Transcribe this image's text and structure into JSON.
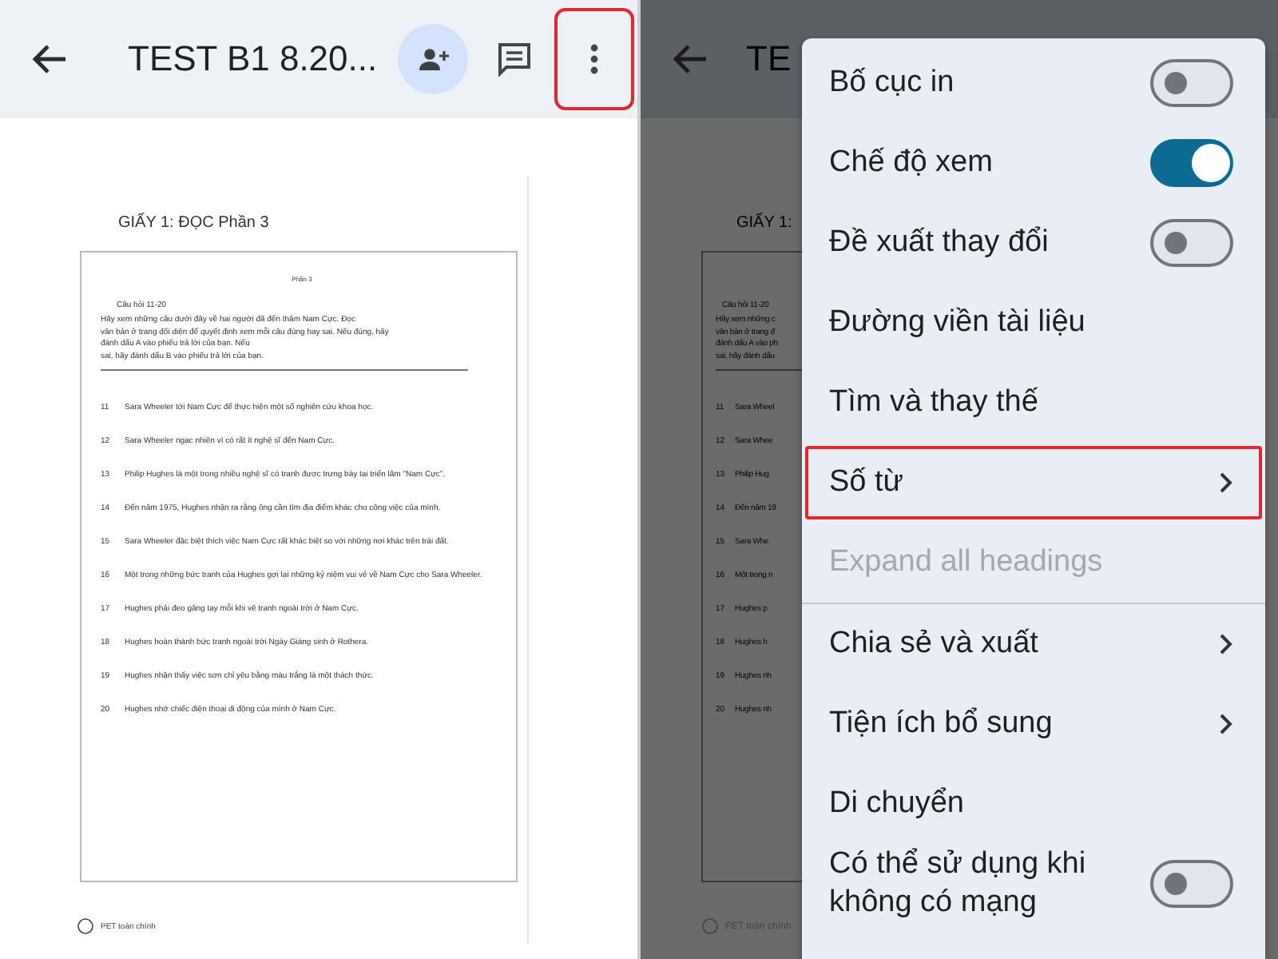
{
  "left_screen": {
    "top_bar": {
      "title": "TEST B1 8.20...",
      "actions": [
        {
          "kind": "add-person",
          "highlighted": false
        },
        {
          "kind": "comment",
          "highlighted": false
        },
        {
          "kind": "more",
          "highlighted": true
        }
      ]
    },
    "document": {
      "heading": "GIẤY 1: ĐỌC Phần 3",
      "section_label": "Phần 3",
      "question_range": "Câu hỏi 11-20",
      "instruction_lines": [
        "Hãy xem những câu dưới đây về hai người đã đến thăm Nam Cực. Đọc",
        "văn bản ở trang đối diện để quyết định xem mỗi câu đúng hay sai. Nếu đúng, hãy",
        "đánh dấu A vào phiếu trả lời của bạn. Nếu",
        "sai, hãy đánh dấu B vào phiếu trả lời của bạn."
      ],
      "statements": [
        {
          "number": "11",
          "text": "Sara Wheeler tới Nam Cực để thực hiện một số nghiên cứu khoa học."
        },
        {
          "number": "12",
          "text": "Sara Wheeler ngạc nhiên vì có rất ít nghệ sĩ đến Nam Cực."
        },
        {
          "number": "13",
          "text": "Philip Hughes là một trong nhiều nghệ sĩ có tranh được trưng bày tại triển lãm \"Nam Cực\"."
        },
        {
          "number": "14",
          "text": "Đến năm 1975, Hughes nhận ra rằng ông cần tìm địa điểm khác cho công việc của mình."
        },
        {
          "number": "15",
          "text": "Sara Wheeler đặc biệt thích việc Nam Cực rất khác biệt so với những nơi khác trên trái đất."
        },
        {
          "number": "16",
          "text": "Một trong những bức tranh của Hughes gợi lại những kỷ niệm vui vẻ về Nam Cực cho Sara Wheeler."
        },
        {
          "number": "17",
          "text": "Hughes phải đeo găng tay mỗi khi vẽ tranh ngoài trời ở Nam Cực."
        },
        {
          "number": "18",
          "text": "Hughes hoàn thành bức tranh ngoài trời Ngày Giáng sinh ở Rothera."
        },
        {
          "number": "19",
          "text": "Hughes nhận thấy việc sơn chỉ yêu bằng màu trắng là một thách thức."
        },
        {
          "number": "20",
          "text": "Hughes nhớ chiếc điện thoại di động của mình ở Nam Cực."
        }
      ],
      "footer": "PET toàn chính"
    }
  },
  "right_screen": {
    "top_bar": {
      "title": "TE"
    },
    "document": {
      "heading": "GIẤY 1:",
      "question_range": "Câu hỏi 11-20",
      "instruction_lines": [
        "Hãy xem những c",
        "văn bản ở trang đ",
        "đánh dấu A vào ph",
        "sai, hãy đánh dấu"
      ],
      "statements": [
        {
          "number": "11",
          "text": "Sara Wheel"
        },
        {
          "number": "12",
          "text": "Sara Whee"
        },
        {
          "number": "13",
          "text": "Philip Hug"
        },
        {
          "number": "14",
          "text": "Đến năm 19"
        },
        {
          "number": "15",
          "text": "Sara Whe"
        },
        {
          "number": "16",
          "text": "Một trong n"
        },
        {
          "number": "17",
          "text": "Hughes p"
        },
        {
          "number": "18",
          "text": "Hughes h"
        },
        {
          "number": "19",
          "text": "Hughes nh"
        },
        {
          "number": "20",
          "text": "Hughes nh"
        }
      ],
      "footer": "PET toàn chính"
    },
    "menu": {
      "items": [
        {
          "label": "Bố cục in",
          "kind": "toggle",
          "on": false,
          "disabled": false,
          "highlighted": false,
          "divider_before": false
        },
        {
          "label": "Chế độ xem",
          "kind": "toggle",
          "on": true,
          "disabled": false,
          "highlighted": false,
          "divider_before": false
        },
        {
          "label": "Đề xuất thay đổi",
          "kind": "toggle",
          "on": false,
          "disabled": false,
          "highlighted": false,
          "divider_before": false
        },
        {
          "label": "Đường viền tài liệu",
          "kind": "plain",
          "disabled": false,
          "highlighted": false,
          "divider_before": false
        },
        {
          "label": "Tìm và thay thế",
          "kind": "plain",
          "disabled": false,
          "highlighted": false,
          "divider_before": false
        },
        {
          "label": "Số từ",
          "kind": "submenu",
          "disabled": false,
          "highlighted": true,
          "divider_before": false
        },
        {
          "label": "Expand all headings",
          "kind": "plain",
          "disabled": true,
          "highlighted": false,
          "divider_before": false
        },
        {
          "label": "Chia sẻ và xuất",
          "kind": "submenu",
          "disabled": false,
          "highlighted": false,
          "divider_before": true
        },
        {
          "label": "Tiện ích bổ sung",
          "kind": "submenu",
          "disabled": false,
          "highlighted": false,
          "divider_before": false
        },
        {
          "label": "Di chuyển",
          "kind": "plain",
          "disabled": false,
          "highlighted": false,
          "divider_before": false
        },
        {
          "label": "Có thể sử dụng khi không có mạng",
          "kind": "toggle",
          "on": false,
          "disabled": false,
          "highlighted": false,
          "divider_before": false
        }
      ]
    }
  }
}
